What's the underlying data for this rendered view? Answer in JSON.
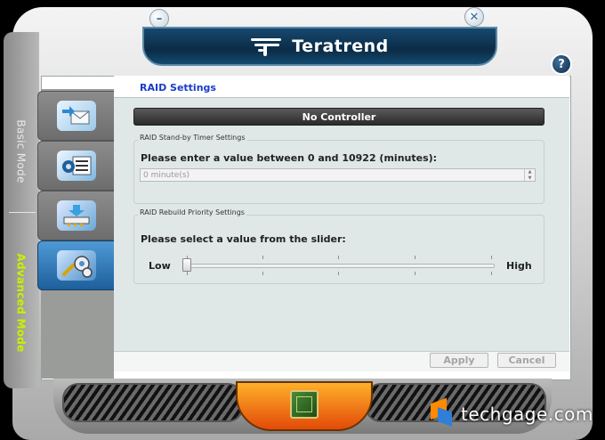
{
  "app": {
    "brand": "Teratrend",
    "minimize_glyph": "–",
    "close_glyph": "✕",
    "help_glyph": "?"
  },
  "sidebar": {
    "modes": [
      {
        "label": "Basic Mode",
        "active": false
      },
      {
        "label": "Advanced Mode",
        "active": true
      }
    ],
    "tabs": [
      {
        "icon": "email-transfer-icon",
        "active": false
      },
      {
        "icon": "settings-list-icon",
        "active": false
      },
      {
        "icon": "drive-download-icon",
        "active": false
      },
      {
        "icon": "tools-gears-icon",
        "active": true
      }
    ]
  },
  "panel": {
    "title": "RAID Settings",
    "controller": "No Controller",
    "standby": {
      "legend": "RAID Stand-by Timer Settings",
      "prompt": "Please enter a value between 0 and 10922 (minutes):",
      "value": "0 minute(s)",
      "up_glyph": "▲",
      "down_glyph": "▼"
    },
    "rebuild": {
      "legend": "RAID Rebuild Priority Settings",
      "prompt": "Please select a value from the slider:",
      "low_label": "Low",
      "high_label": "High",
      "slider_value": 0
    },
    "buttons": {
      "apply": "Apply",
      "cancel": "Cancel"
    }
  },
  "watermark": {
    "text": "techgage.com"
  },
  "colors": {
    "title_blue": "#1a3cc8",
    "advanced_mode_green": "#c8f000",
    "panel_bg": "#dfe8e6",
    "header_navy": "#0b2b46"
  }
}
